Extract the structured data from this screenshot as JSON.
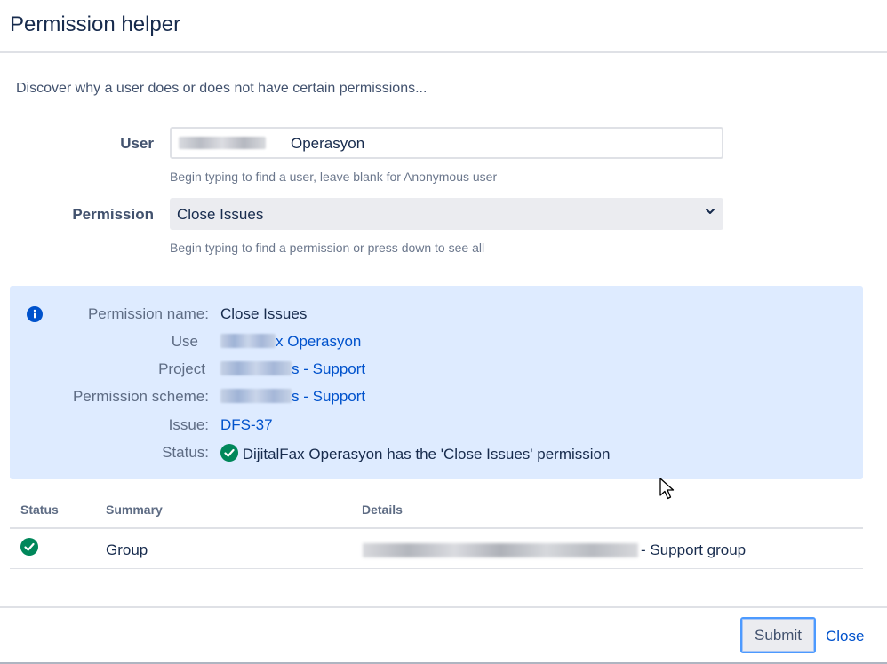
{
  "dialog": {
    "title": "Permission helper"
  },
  "intro": "Discover why a user does or does not have certain permissions...",
  "form": {
    "user": {
      "label": "User",
      "value_suffix": "Operasyon",
      "help": "Begin typing to find a user, leave blank for Anonymous user"
    },
    "permission": {
      "label": "Permission",
      "selected": "Close Issues",
      "help": "Begin typing to find a permission or press down to see all"
    }
  },
  "info": {
    "icon": "info-icon",
    "permission_name": {
      "label": "Permission name:",
      "value": "Close Issues"
    },
    "user": {
      "label": "Use",
      "value_suffix": "x Operasyon"
    },
    "project": {
      "label": "Project",
      "value_suffix": "s - Support"
    },
    "permission_scheme": {
      "label": "Permission scheme:",
      "value_suffix": "s - Support"
    },
    "issue": {
      "label": "Issue:",
      "value": "DFS-37"
    },
    "status": {
      "label": "Status:",
      "icon": "check-circle-icon",
      "text": "DijitalFax Operasyon has the 'Close Issues' permission"
    }
  },
  "table": {
    "headers": {
      "status": "Status",
      "summary": "Summary",
      "details": "Details"
    },
    "rows": [
      {
        "status_icon": "check-circle-icon",
        "summary": "Group",
        "details_suffix": "- Support group"
      }
    ]
  },
  "footer": {
    "submit_label": "Submit",
    "close_label": "Close"
  },
  "colors": {
    "info_bg": "#deebff",
    "link": "#0052cc",
    "success": "#00875a",
    "info_icon": "#0052cc"
  }
}
